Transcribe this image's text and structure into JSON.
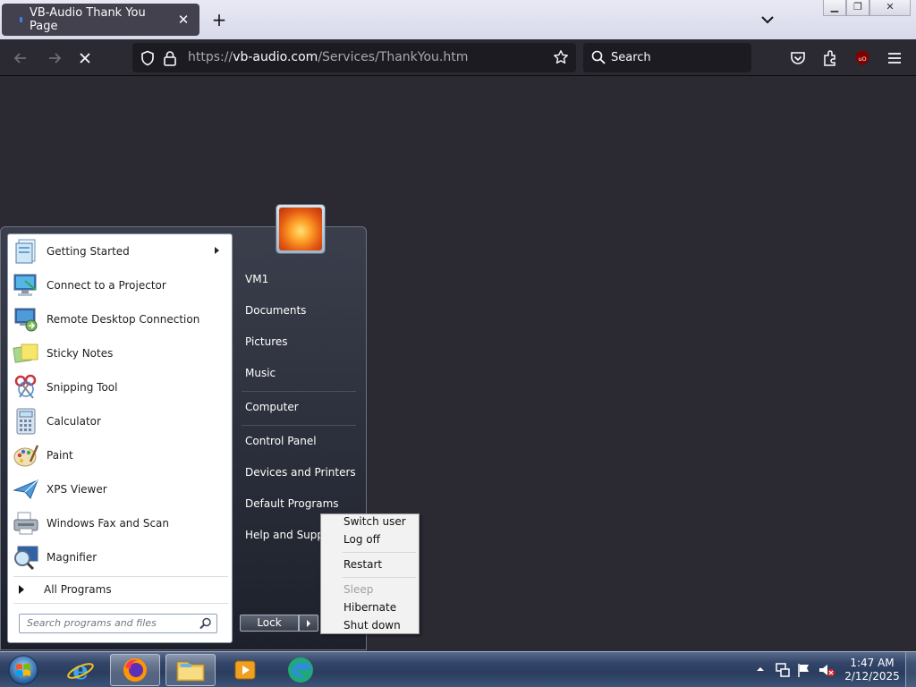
{
  "browser": {
    "tab_title": "VB-Audio Thank You Page",
    "url_prefix": "https://",
    "url_host": "vb-audio.com",
    "url_path": "/Services/ThankYou.htm",
    "search_placeholder": "Search"
  },
  "start_menu": {
    "programs": [
      {
        "label": "Getting Started",
        "icon": "getting-started-icon",
        "has_submenu": true
      },
      {
        "label": "Connect to a Projector",
        "icon": "projector-icon"
      },
      {
        "label": "Remote Desktop Connection",
        "icon": "remote-desktop-icon"
      },
      {
        "label": "Sticky Notes",
        "icon": "sticky-notes-icon"
      },
      {
        "label": "Snipping Tool",
        "icon": "snipping-tool-icon"
      },
      {
        "label": "Calculator",
        "icon": "calculator-icon"
      },
      {
        "label": "Paint",
        "icon": "paint-icon"
      },
      {
        "label": "XPS Viewer",
        "icon": "xps-viewer-icon"
      },
      {
        "label": "Windows Fax and Scan",
        "icon": "fax-scan-icon"
      },
      {
        "label": "Magnifier",
        "icon": "magnifier-icon"
      }
    ],
    "all_programs": "All Programs",
    "search_placeholder": "Search programs and files",
    "right_links": [
      "VM1",
      "Documents",
      "Pictures",
      "Music",
      "Computer",
      "Control Panel",
      "Devices and Printers",
      "Default Programs",
      "Help and Suppo"
    ],
    "lock_label": "Lock"
  },
  "shutdown_menu": {
    "items": [
      "Switch user",
      "Log off",
      "Restart",
      "Sleep",
      "Hibernate",
      "Shut down"
    ],
    "disabled": [
      "Sleep"
    ]
  },
  "taskbar": {
    "time": "1:47 AM",
    "date": "2/12/2025"
  },
  "colors": {
    "browser_bg": "#2b2a33",
    "taskbar": "#2a3d5e",
    "accent": "#3b82f6"
  }
}
